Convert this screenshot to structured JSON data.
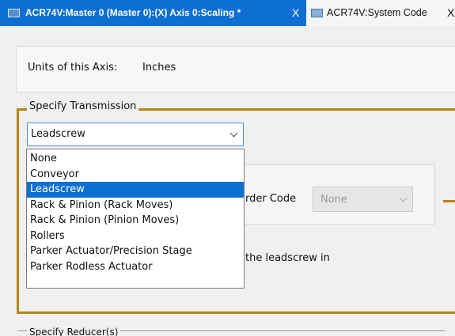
{
  "tabs": [
    {
      "title": "ACR74V:Master 0 (Master 0):(X) Axis 0:Scaling *",
      "close": "X"
    },
    {
      "title": "ACR74V:System Code",
      "close": "X"
    }
  ],
  "units": {
    "label": "Units of this Axis:",
    "value": "Inches"
  },
  "transmission": {
    "legend": "Specify Transmission",
    "selected": "Leadscrew",
    "options": [
      "None",
      "Conveyor",
      "Leadscrew",
      "Rack & Pinion (Rack Moves)",
      "Rack & Pinion (Pinion Moves)",
      "Rollers",
      "Parker Actuator/Precision Stage",
      "Parker Rodless Actuator"
    ],
    "highlighted_index": 2
  },
  "encoder": {
    "label_fragment": "rder Code",
    "value": "None"
  },
  "description_fragment": "the leadscrew in",
  "reducer": {
    "legend": "Specify Reducer(s)"
  },
  "colors": {
    "accent": "#0d6fd1",
    "group_border": "#b8860b"
  }
}
